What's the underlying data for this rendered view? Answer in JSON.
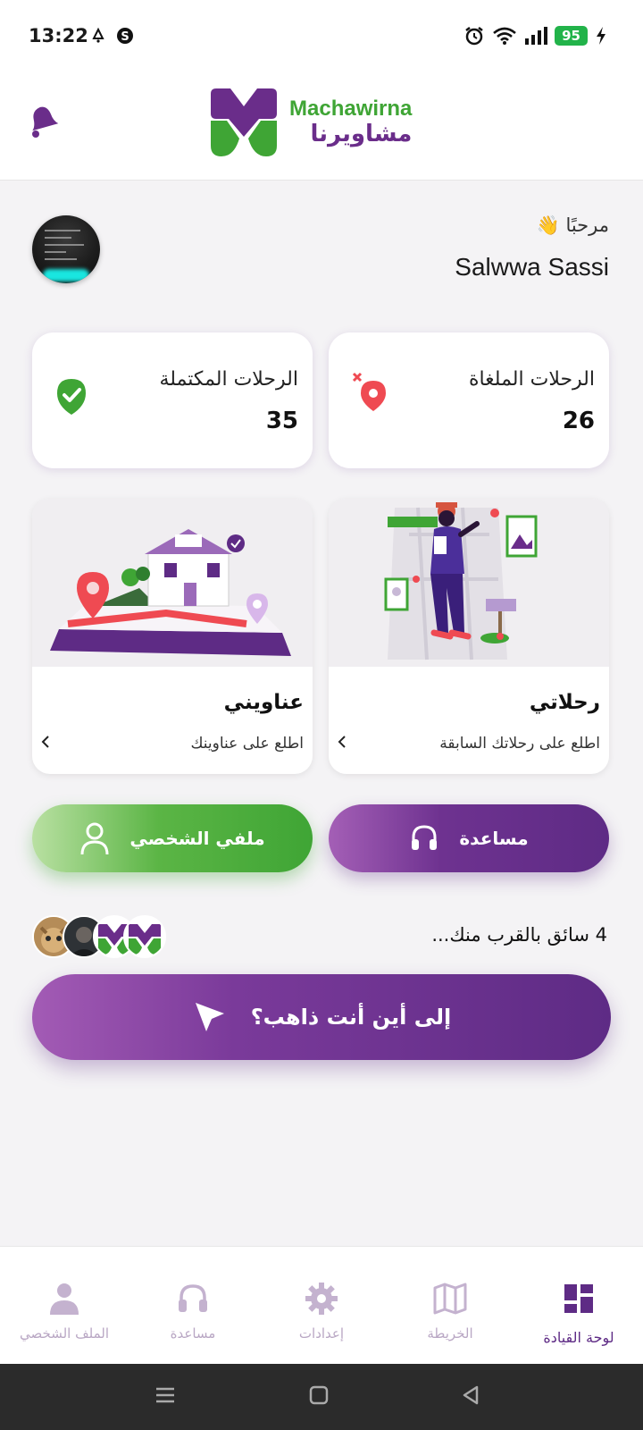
{
  "status_bar": {
    "time": "13:22",
    "battery": "95"
  },
  "brand": {
    "name_en": "Machawirna",
    "name_ar": "مشاويرنا",
    "primary": "#5e2b85",
    "secondary": "#3fa535"
  },
  "greeting": {
    "hello": "مرحبًا",
    "wave": "👋",
    "user_name": "Salwwa Sassi"
  },
  "stats": {
    "cancelled": {
      "label": "الرحلات الملغاة",
      "value": "26",
      "icon": "cancelled-location-icon"
    },
    "completed": {
      "label": "الرحلات المكتملة",
      "value": "35",
      "icon": "check-shield-icon"
    }
  },
  "features": {
    "trips": {
      "title": "رحلاتي",
      "subtitle": "اطلع على رحلاتك السابقة"
    },
    "addresses": {
      "title": "عناويني",
      "subtitle": "اطلع على عناوينك"
    }
  },
  "actions": {
    "help": "مساعدة",
    "profile": "ملفي الشخصي"
  },
  "drivers": {
    "text": "4 سائق بالقرب منك..."
  },
  "where_to": {
    "label": "إلى أين أنت ذاهب؟"
  },
  "bottom_nav": {
    "items": [
      {
        "label": "الملف الشخصي",
        "icon": "person-icon"
      },
      {
        "label": "مساعدة",
        "icon": "headset-icon"
      },
      {
        "label": "إعدادات",
        "icon": "gear-icon"
      },
      {
        "label": "الخريطة",
        "icon": "map-icon"
      },
      {
        "label": "لوحة القيادة",
        "icon": "dashboard-icon"
      }
    ],
    "active_index": 4
  }
}
